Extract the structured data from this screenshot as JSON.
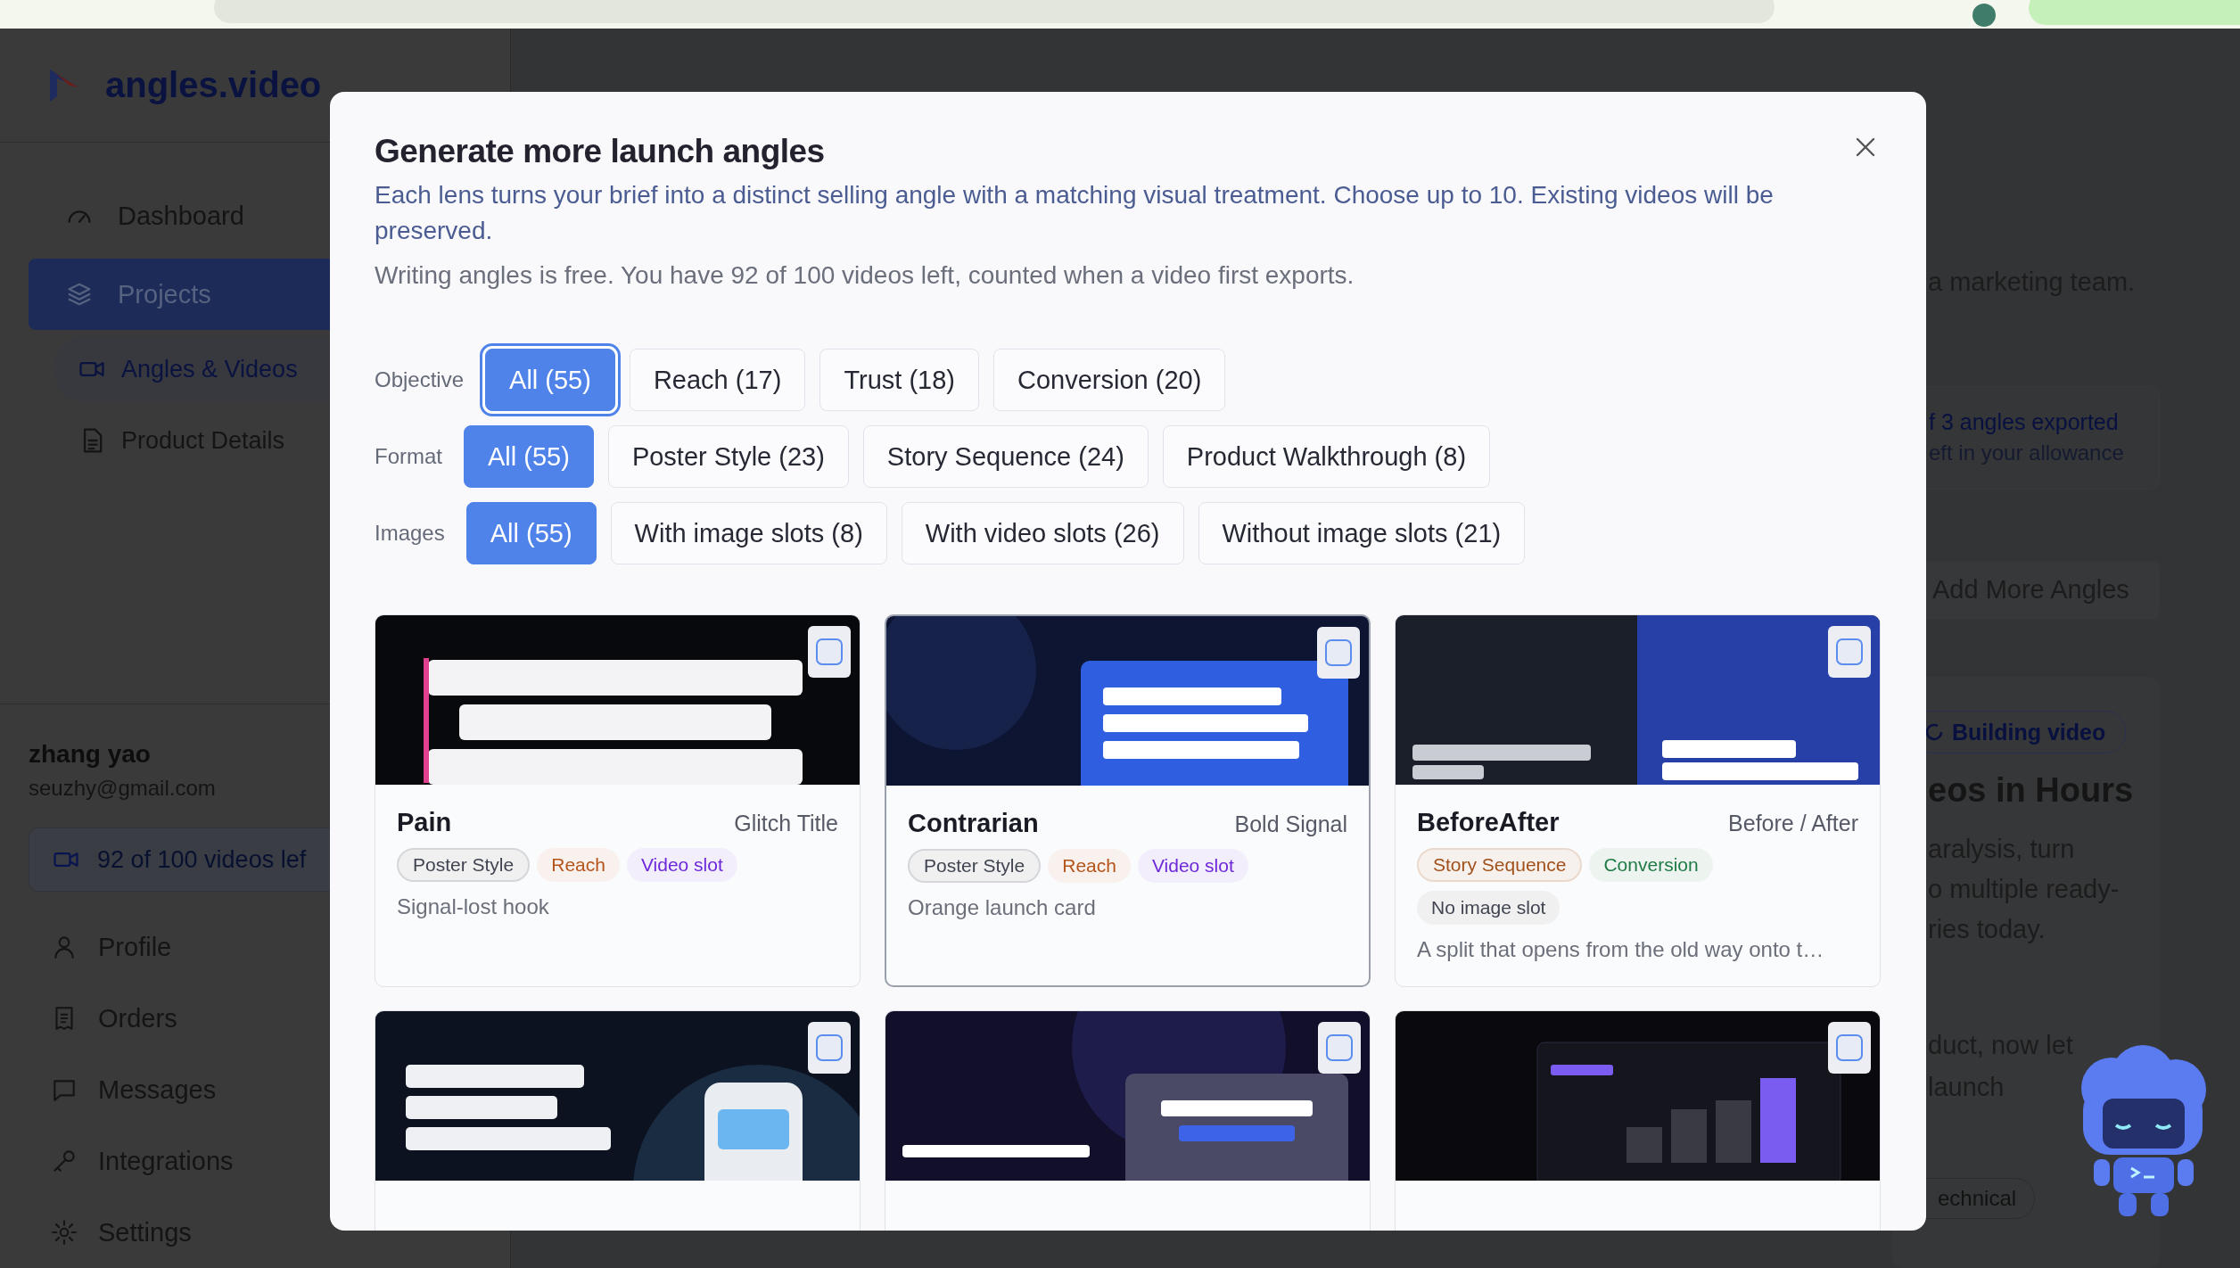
{
  "sidebar": {
    "brand": "angles.video",
    "nav": [
      {
        "label": "Dashboard",
        "selected": false
      },
      {
        "label": "Projects",
        "selected": true,
        "children": [
          {
            "label": "Angles & Videos",
            "selected": true
          },
          {
            "label": "Product Details",
            "selected": false
          }
        ]
      }
    ],
    "user": {
      "name": "zhang yao",
      "email": "seuzhy@gmail.com"
    },
    "allowance": "92 of 100 videos lef",
    "menu": [
      "Profile",
      "Orders",
      "Messages",
      "Integrations",
      "Settings"
    ]
  },
  "main": {
    "intro_tail": "a marketing team.",
    "export_status": {
      "title": "f 3 angles exported",
      "subtitle": "eft in your allowance"
    },
    "add_button": "Add More Angles",
    "project_card": {
      "status": "Building video",
      "title": "eos in Hours",
      "body": [
        "aralysis, turn",
        "o multiple ready-",
        "ries today."
      ],
      "body_2": [
        "duct, now let",
        "launch"
      ],
      "tag": "echnical"
    }
  },
  "modal": {
    "title": "Generate more launch angles",
    "description": "Each lens turns your brief into a distinct selling angle with a matching visual treatment. Choose up to 10. Existing videos will be preserved.",
    "note": "Writing angles is free. You have 92 of 100 videos left, counted when a video first exports.",
    "filters": [
      {
        "label": "Objective",
        "options": [
          {
            "label": "All (55)",
            "selected": true,
            "focused": true
          },
          {
            "label": "Reach (17)",
            "selected": false,
            "focused": false
          },
          {
            "label": "Trust (18)",
            "selected": false,
            "focused": false
          },
          {
            "label": "Conversion (20)",
            "selected": false,
            "focused": false
          }
        ]
      },
      {
        "label": "Format",
        "options": [
          {
            "label": "All (55)",
            "selected": true,
            "focused": false
          },
          {
            "label": "Poster Style (23)",
            "selected": false,
            "focused": false
          },
          {
            "label": "Story Sequence (24)",
            "selected": false,
            "focused": false
          },
          {
            "label": "Product Walkthrough (8)",
            "selected": false,
            "focused": false
          }
        ]
      },
      {
        "label": "Images",
        "options": [
          {
            "label": "All (55)",
            "selected": true,
            "focused": false
          },
          {
            "label": "With image slots (8)",
            "selected": false,
            "focused": false
          },
          {
            "label": "With video slots (26)",
            "selected": false,
            "focused": false
          },
          {
            "label": "Without image slots (21)",
            "selected": false,
            "focused": false
          }
        ]
      }
    ],
    "cards": [
      {
        "title": "Pain",
        "style": "Glitch Title",
        "checked": false,
        "focused": false,
        "tags": [
          {
            "label": "Poster Style",
            "kind": "format",
            "color": "#3f4450"
          },
          {
            "label": "Reach",
            "kind": "plain",
            "color": "#b4541a"
          },
          {
            "label": "Video slot",
            "kind": "plain",
            "color": "#6d28d9"
          }
        ],
        "description": "Signal-lost hook"
      },
      {
        "title": "Contrarian",
        "style": "Bold Signal",
        "checked": false,
        "focused": true,
        "tags": [
          {
            "label": "Poster Style",
            "kind": "format",
            "color": "#3f4450"
          },
          {
            "label": "Reach",
            "kind": "plain",
            "color": "#b4541a"
          },
          {
            "label": "Video slot",
            "kind": "plain",
            "color": "#6d28d9"
          }
        ],
        "description": "Orange launch card"
      },
      {
        "title": "BeforeAfter",
        "style": "Before / After",
        "checked": false,
        "focused": false,
        "tags": [
          {
            "label": "Story Sequence",
            "kind": "format",
            "color": "#a0501a"
          },
          {
            "label": "Conversion",
            "kind": "plain",
            "color": "#1f7a45"
          },
          {
            "label": "No image slot",
            "kind": "plain",
            "color": "#3f4450"
          }
        ],
        "description": "A split that opens from the old way onto t…"
      },
      {
        "checked": false,
        "focused": false
      },
      {
        "checked": false,
        "focused": false
      },
      {
        "checked": false,
        "focused": false
      }
    ]
  }
}
